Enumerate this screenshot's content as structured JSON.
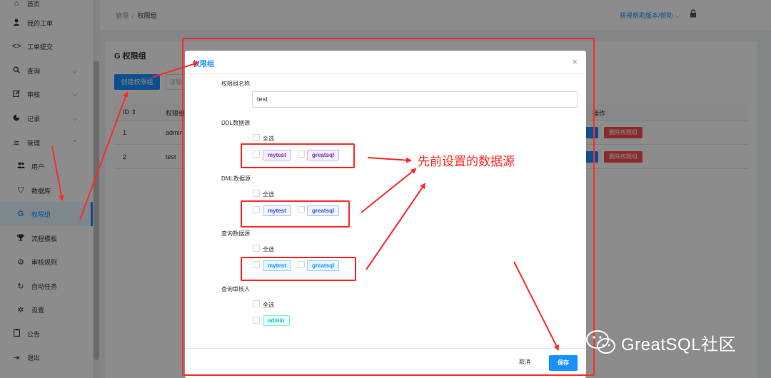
{
  "sidebar": {
    "items": [
      {
        "icon": "home-icon",
        "label": "首页"
      },
      {
        "icon": "user-icon",
        "label": "我的工单"
      },
      {
        "icon": "code-icon",
        "label": "工单提交"
      },
      {
        "icon": "search-icon",
        "label": "查询"
      },
      {
        "icon": "edit-icon",
        "label": "审核"
      },
      {
        "icon": "pie-icon",
        "label": "记录"
      },
      {
        "icon": "database-stack-icon",
        "label": "管理"
      },
      {
        "icon": "team-icon",
        "label": "用户"
      },
      {
        "icon": "database-icon",
        "label": "数据库"
      },
      {
        "icon": "google-g-icon",
        "label": "权限组"
      },
      {
        "icon": "trophy-icon",
        "label": "流程模板"
      },
      {
        "icon": "gear-ring-icon",
        "label": "审核规则"
      },
      {
        "icon": "sync-icon",
        "label": "自动任务"
      },
      {
        "icon": "settings-icon",
        "label": "设置"
      },
      {
        "icon": "clipboard-icon",
        "label": "公告"
      },
      {
        "icon": "logout-icon",
        "label": "退出"
      }
    ]
  },
  "header": {
    "breadcrumb_root": "管理",
    "breadcrumb_sep": "/",
    "breadcrumb_current": "权限组",
    "help_text": "获得帮助版本/帮助 ⌵"
  },
  "page": {
    "title": "G 权限组",
    "create_button": "创建权限组",
    "search_placeholder": "请输",
    "columns": {
      "id": "ID ⇕",
      "name": "权限组",
      "action": "操作"
    },
    "rows": [
      {
        "id": "1",
        "name": "admin",
        "delete": "删除权限组"
      },
      {
        "id": "2",
        "name": "test",
        "delete": "删除权限组"
      }
    ]
  },
  "modal": {
    "title": "权限组",
    "close": "×",
    "name_label": "权限组名称",
    "name_value": "test",
    "sections": [
      {
        "label": "DDL数据源",
        "select_all": "全选",
        "tags": [
          "mytest",
          "greatsql"
        ],
        "color": "purple"
      },
      {
        "label": "DML数据源",
        "select_all": "全选",
        "tags": [
          "mytest",
          "greatsql"
        ],
        "color": "blue"
      },
      {
        "label": "查询数据源",
        "select_all": "全选",
        "tags": [
          "mytest",
          "greatsql"
        ],
        "color": "cyan"
      },
      {
        "label": "查询审核人",
        "select_all": "全选",
        "tags": [
          "admin"
        ],
        "color": "teal"
      }
    ],
    "cancel": "取消",
    "save": "保存"
  },
  "annotation": {
    "text": "先前设置的数据源",
    "color": "#ff2a2a"
  },
  "watermark": {
    "text": "GreatSQL社区"
  },
  "colors": {
    "primary": "#1890ff",
    "danger": "#ff4d4f",
    "annotation": "#ff2a2a"
  }
}
